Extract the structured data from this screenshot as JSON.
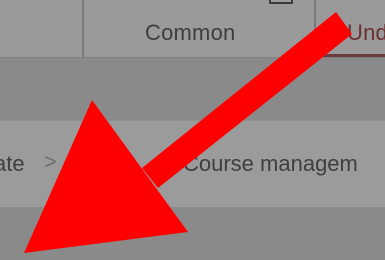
{
  "tabs": [
    {
      "label": ""
    },
    {
      "label": "Common"
    },
    {
      "label": "Und"
    }
  ],
  "breadcrumb": {
    "items": [
      {
        "label": "ate"
      },
      {
        "label": ""
      },
      {
        "label": "Course managem"
      }
    ],
    "separator": ">"
  },
  "annotation": {
    "type": "arrow",
    "color": "#ff0000"
  }
}
